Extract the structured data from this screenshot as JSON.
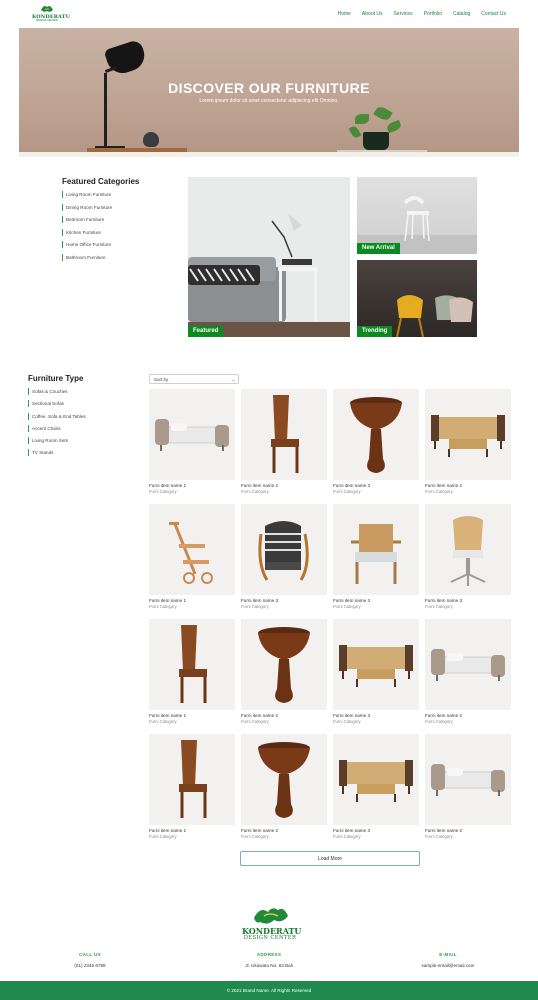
{
  "brand": {
    "name": "KONDERATU",
    "tagline": "DESIGN CENTER"
  },
  "nav": {
    "items": [
      "Home",
      "About Us",
      "Services",
      "Portfolio",
      "Catalog",
      "Contact Us"
    ]
  },
  "hero": {
    "title": "DISCOVER OUR FURNITURE",
    "subtitle": "Lorem ipsum dolor sit amet consectetur adipiscing elit Omnino."
  },
  "featured": {
    "title": "Featured Categories",
    "items": [
      "Living Room Furniture",
      "Dining Room Furniture",
      "Bedroom Furniture",
      "Kitchen Furniture",
      "Home Office Furniture",
      "Bathroom Furniture"
    ],
    "tiles": [
      "Featured",
      "New Arrival",
      "Trending"
    ]
  },
  "types": {
    "title": "Furniture Type",
    "items": [
      "Sofas & Couches",
      "Sectional Sofas",
      "Coffee, Sofa & End Tables",
      "Accent Chairs",
      "Living Room Sets",
      "TV Stands"
    ]
  },
  "sort": {
    "label": "Sort by"
  },
  "products": [
    {
      "name": "Furni item name 1",
      "category": "Furni Category",
      "icon": "bed-icon"
    },
    {
      "name": "Furni item name 2",
      "category": "Furni Category",
      "icon": "wood-chair-icon"
    },
    {
      "name": "Furni item name 3",
      "category": "Furni Category",
      "icon": "pedestal-table-icon"
    },
    {
      "name": "Furni item name 2",
      "category": "Furni Category",
      "icon": "sofa-set-icon"
    },
    {
      "name": "Furni item name 1",
      "category": "Furni Category",
      "icon": "cart-icon"
    },
    {
      "name": "Furni item name 3",
      "category": "Furni Category",
      "icon": "striped-chair-icon"
    },
    {
      "name": "Furni item name 3",
      "category": "Furni Category",
      "icon": "rattan-chair-icon"
    },
    {
      "name": "Furni item name 3",
      "category": "Furni Category",
      "icon": "office-chair-icon"
    },
    {
      "name": "Furni item name 1",
      "category": "Furni Category",
      "icon": "wood-chair-icon"
    },
    {
      "name": "Furni item name 2",
      "category": "Furni Category",
      "icon": "pedestal-table-icon"
    },
    {
      "name": "Furni item name 3",
      "category": "Furni Category",
      "icon": "sofa-set-icon"
    },
    {
      "name": "Furni item name 2",
      "category": "Furni Category",
      "icon": "bed-icon"
    },
    {
      "name": "Furni item name 1",
      "category": "Furni Category",
      "icon": "wood-chair-icon"
    },
    {
      "name": "Furni item name 2",
      "category": "Furni Category",
      "icon": "pedestal-table-icon"
    },
    {
      "name": "Furni item name 3",
      "category": "Furni Category",
      "icon": "sofa-set-icon"
    },
    {
      "name": "Furni item name 2",
      "category": "Furni Category",
      "icon": "bed-icon"
    }
  ],
  "load_more": "Load More",
  "footer": {
    "call": {
      "label": "CALL US",
      "value": "(01) 2345 6789"
    },
    "address": {
      "label": "ADDRESS",
      "value": "Jl. Ukuwatu No. 63 Bali"
    },
    "email": {
      "label": "E-MAIL",
      "value": "sample-email@email.com"
    },
    "copyright": "© 2021 Brand Name. All Rights Reserved"
  },
  "colors": {
    "brand_green": "#0f7a2a",
    "accent_green": "#2e9e46",
    "footer_bar": "#1f8a4c",
    "label_green": "#0a8a1f"
  }
}
